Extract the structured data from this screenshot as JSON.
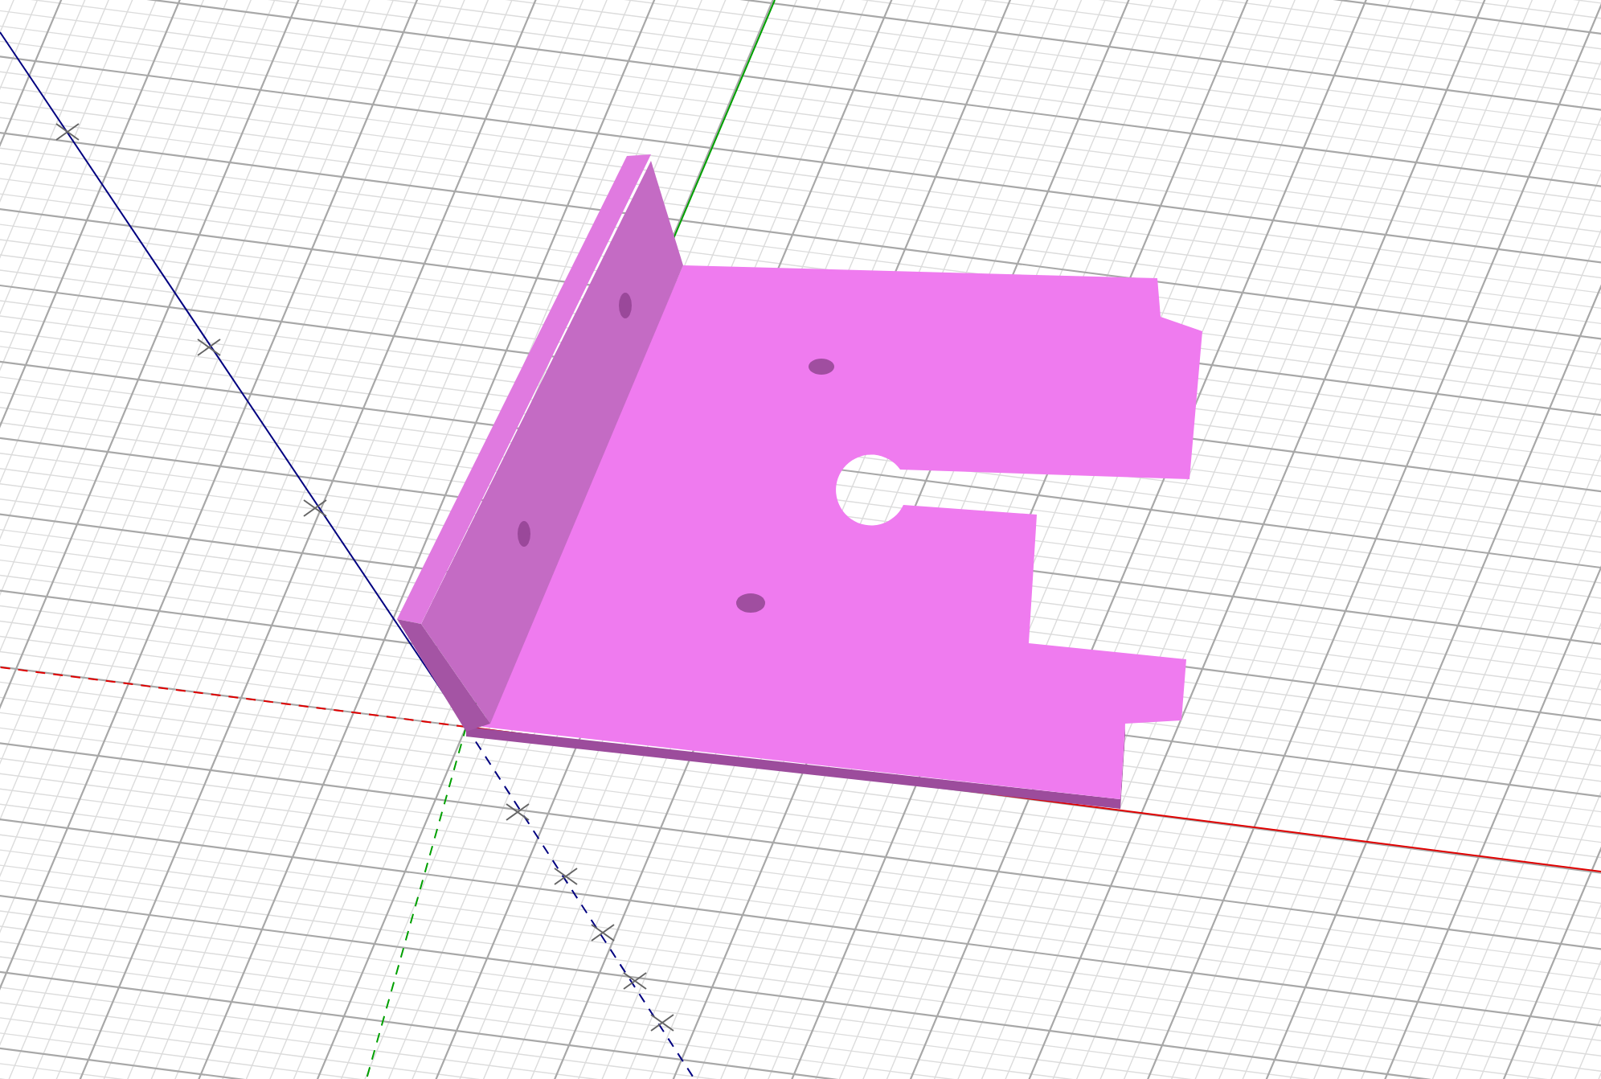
{
  "axes": [
    {
      "kind": "x",
      "color": "#e00000"
    },
    {
      "kind": "y",
      "color": "#00a000"
    },
    {
      "kind": "z",
      "color": "#000080"
    }
  ]
}
